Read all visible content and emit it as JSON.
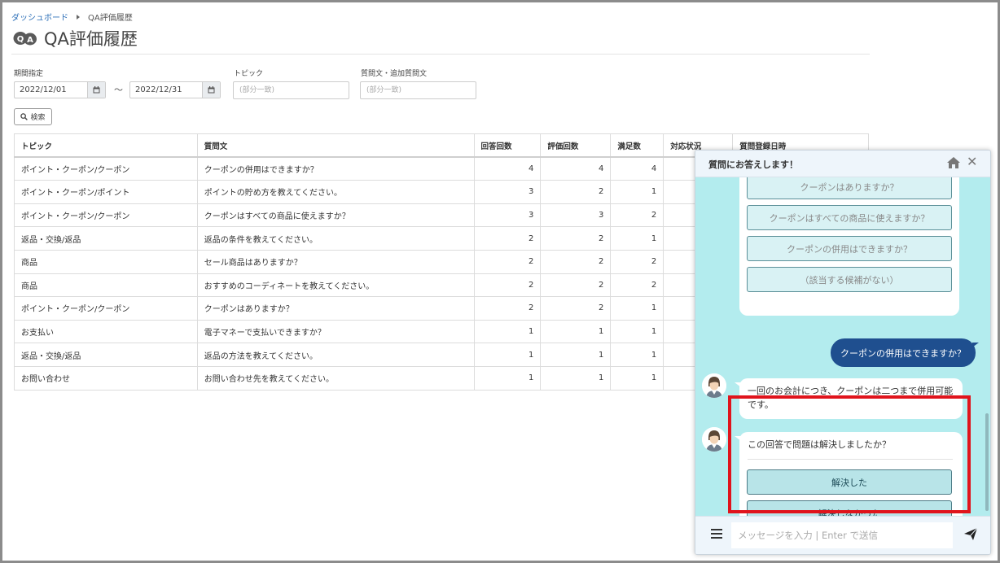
{
  "breadcrumb": {
    "home": "ダッシュボード",
    "current": "QA評価履歴"
  },
  "page": {
    "title": "QA評価履歴"
  },
  "filters": {
    "period_label": "期間指定",
    "date_from": "2022/12/01",
    "date_separator": "～",
    "date_to": "2022/12/31",
    "topic_label": "トピック",
    "topic_placeholder": "(部分一致)",
    "question_label": "質問文・追加質問文",
    "question_placeholder": "(部分一致)",
    "search_label": "検索"
  },
  "table": {
    "columns": [
      "トピック",
      "質問文",
      "回答回数",
      "評価回数",
      "満足数",
      "対応状況",
      "質問登録日時"
    ],
    "rows": [
      [
        "ポイント・クーポン/クーポン",
        "クーポンの併用はできますか？",
        "4",
        "4",
        "4"
      ],
      [
        "ポイント・クーポン/ポイント",
        "ポイントの貯め方を教えてください。",
        "3",
        "2",
        "1"
      ],
      [
        "ポイント・クーポン/クーポン",
        "クーポンはすべての商品に使えますか？",
        "3",
        "3",
        "2"
      ],
      [
        "返品・交換/返品",
        "返品の条件を教えてください。",
        "2",
        "2",
        "1"
      ],
      [
        "商品",
        "セール商品はありますか？",
        "2",
        "2",
        "2"
      ],
      [
        "商品",
        "おすすめのコーディネートを教えてください。",
        "2",
        "2",
        "2"
      ],
      [
        "ポイント・クーポン/クーポン",
        "クーポンはありますか？",
        "2",
        "2",
        "1"
      ],
      [
        "お支払い",
        "電子マネーで支払いできますか？",
        "1",
        "1",
        "1"
      ],
      [
        "返品・交換/返品",
        "返品の方法を教えてください。",
        "1",
        "1",
        "1"
      ],
      [
        "お問い合わせ",
        "お問い合わせ先を教えてください。",
        "1",
        "1",
        "1"
      ]
    ]
  },
  "chat": {
    "title": "質問にお答えします！",
    "suggestions": [
      "クーポンはありますか？",
      "クーポンはすべての商品に使えますか？",
      "クーポンの併用はできますか？",
      "（該当する候補がない）"
    ],
    "user_message": "クーポンの併用はできますか？",
    "bot_answer": "一回のお会計につき、クーポンは二つまで併用可能です。",
    "feedback_question": "この回答で問題は解決しましたか？",
    "feedback_yes": "解決した",
    "feedback_no": "解決しなかった",
    "input_placeholder": "メッセージを入力 | Enter で送信"
  },
  "colors": {
    "link": "#2c6fb8",
    "chat_bg": "#b3ecee",
    "user_bubble": "#1f4f8f",
    "highlight": "#e0141c"
  },
  "icons": [
    "qa-logo-icon",
    "calendar-icon",
    "search-icon",
    "home-icon",
    "close-icon",
    "menu-icon",
    "send-icon",
    "bot-avatar-icon"
  ]
}
